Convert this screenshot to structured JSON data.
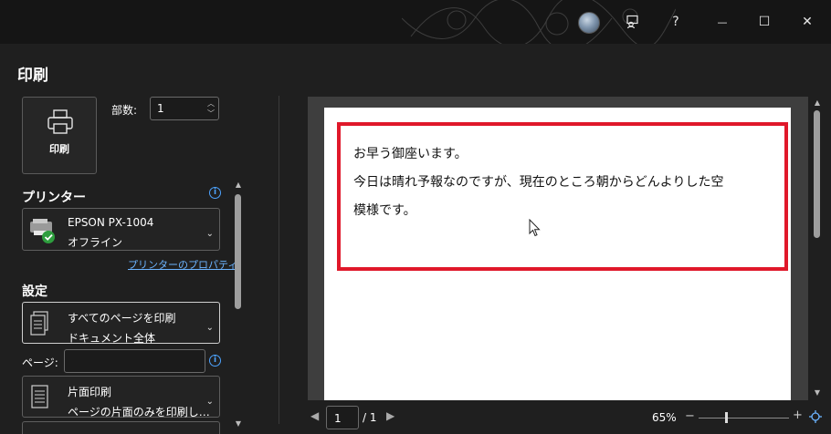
{
  "window": {
    "help_label": "?",
    "minimize_glyph": "—",
    "maximize_glyph": "☐",
    "close_glyph": "✕"
  },
  "print_panel": {
    "title": "印刷",
    "print_button_label": "印刷",
    "copies_label": "部数:",
    "copies_value": "1",
    "printer_header": "プリンター",
    "printer": {
      "name": "EPSON PX-1004",
      "status": "オフライン"
    },
    "printer_properties_link": "プリンターのプロパティ",
    "settings_header": "設定",
    "print_range": {
      "line1": "すべてのページを印刷",
      "line2": "ドキュメント全体"
    },
    "pages_label": "ページ:",
    "pages_value": "",
    "sides": {
      "line1": "片面印刷",
      "line2": "ページの片面のみを印刷し…"
    }
  },
  "preview": {
    "document_lines": [
      "お早う御座います。",
      "今日は晴れ予報なのですが、現在のところ朝からどんよりした空",
      "模様です。"
    ],
    "highlight_color": "#e0182a"
  },
  "navigation": {
    "current_page": "1",
    "total_pages": "/ 1",
    "zoom": "65%",
    "zoom_minus": "−",
    "zoom_plus": "+"
  },
  "colors": {
    "background": "#1f1f1f",
    "accent": "#4da3ff",
    "link": "#6cb4ff"
  }
}
